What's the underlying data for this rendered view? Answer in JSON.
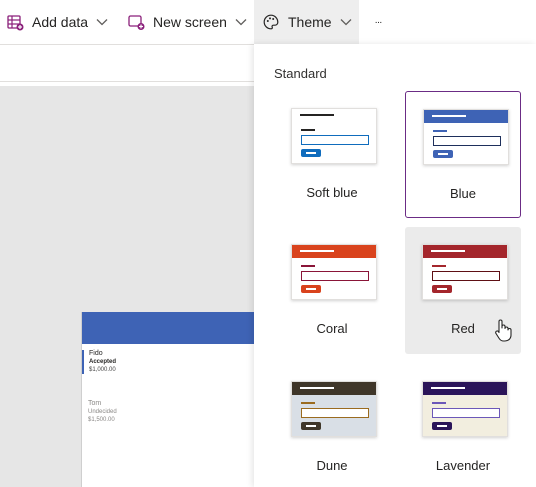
{
  "toolbar": {
    "add_data": "Add data",
    "new_screen": "New screen",
    "theme": "Theme",
    "more": "···"
  },
  "canvas": {
    "records": [
      {
        "name": "Fido",
        "status": "Accepted",
        "amount": "$1,000.00"
      },
      {
        "name": "Tom",
        "status": "Undecided",
        "amount": "$1,500.00"
      }
    ]
  },
  "theme_panel": {
    "section_label": "Standard",
    "selected_theme": "Blue",
    "hovered_theme": "Red",
    "themes": [
      {
        "label": "Soft blue",
        "bar": "#ffffff",
        "bar_line": "#252423",
        "accent_line": "#252423",
        "box": "#0f6cbd",
        "button": "#0f6cbd"
      },
      {
        "label": "Blue",
        "bar": "#3e63b5",
        "bar_line": "#ffffff",
        "accent_line": "#3e63b5",
        "box": "#1e2f5c",
        "button": "#3e63b5"
      },
      {
        "label": "Coral",
        "bar": "#d9431d",
        "bar_line": "#ffffff",
        "accent_line": "#8a1538",
        "box": "#8a1538",
        "button": "#d9431d"
      },
      {
        "label": "Red",
        "bar": "#a4262c",
        "bar_line": "#ffffff",
        "accent_line": "#a4262c",
        "box": "#5e0f14",
        "button": "#a4262c"
      },
      {
        "label": "Dune",
        "bar": "#3f3629",
        "bar_line": "#ffffff",
        "accent_line": "#9b6b1f",
        "box": "#9b6b1f",
        "button": "#3f3629"
      },
      {
        "label": "Lavender",
        "bar": "#2b1559",
        "bar_line": "#ffffff",
        "accent_line": "#6c58b8",
        "box": "#6c58b8",
        "button": "#2b1559"
      }
    ],
    "thumb_backgrounds": [
      "#ffffff",
      "#ffffff",
      "#ffffff",
      "#ffffff",
      "#d9dfe6",
      "#f2eedf"
    ]
  }
}
